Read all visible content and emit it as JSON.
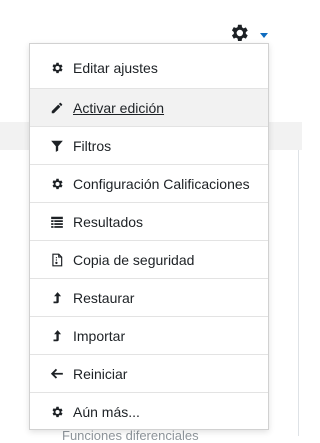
{
  "settings_menu": {
    "items": [
      {
        "label": "Editar ajustes",
        "icon": "gear-icon"
      },
      {
        "label": "Activar edición",
        "icon": "pencil-icon",
        "state": "hover"
      },
      {
        "label": "Filtros",
        "icon": "filter-icon"
      },
      {
        "label": "Configuración Calificaciones",
        "icon": "gear-icon"
      },
      {
        "label": "Resultados",
        "icon": "list-table-icon"
      },
      {
        "label": "Copia de seguridad",
        "icon": "file-archive-icon"
      },
      {
        "label": "Restaurar",
        "icon": "level-up-icon"
      },
      {
        "label": "Importar",
        "icon": "level-up-icon"
      },
      {
        "label": "Reiniciar",
        "icon": "arrow-left-icon"
      },
      {
        "label": "Aún más...",
        "icon": "gear-icon"
      }
    ]
  },
  "settings_trigger": {
    "icon": "gear-icon",
    "caret": "caret-down-icon"
  },
  "background": {
    "peek_text": "Funciones diferenciales"
  },
  "colors": {
    "accent": "#0f6cbf",
    "text": "#1d2125",
    "hover": "#f2f2f2"
  }
}
